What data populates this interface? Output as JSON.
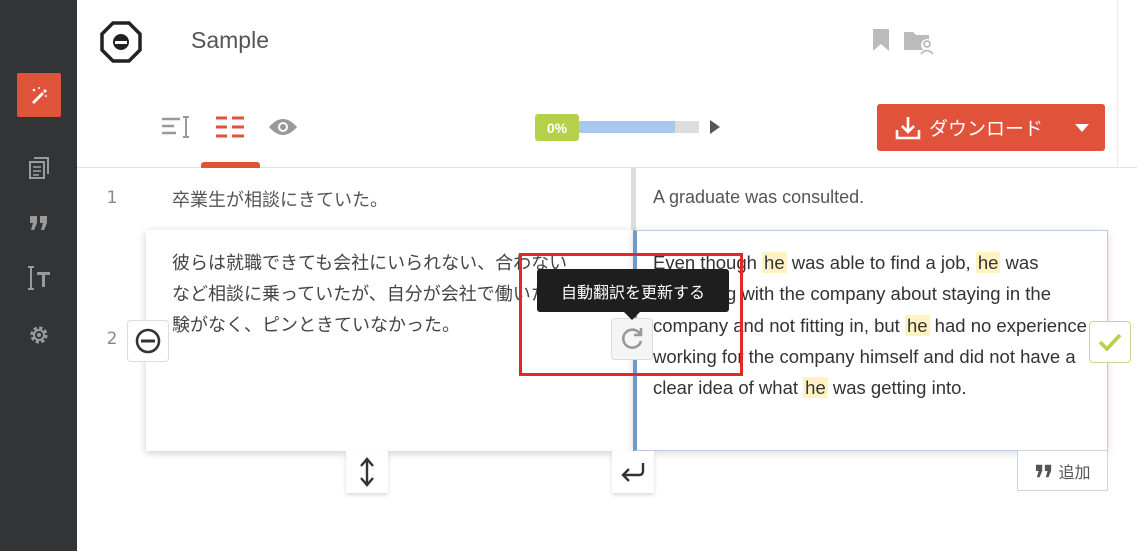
{
  "document": {
    "title": "Sample"
  },
  "progress": {
    "label": "0%",
    "fraction": 0.0,
    "bar_visual_fill": 0.8
  },
  "download": {
    "label": "ダウンロード"
  },
  "segments": [
    {
      "number": "1",
      "source": "卒業生が相談にきていた。",
      "target": "A graduate was consulted."
    },
    {
      "number": "2",
      "source": "彼らは就職できても会社にいられない、合わないなど相談に乗っていたが、自分が会社で働いた経験がなく、ピンときていなかった。",
      "target_parts": [
        "Even though ",
        "he",
        " was able to find a job, ",
        "he",
        " was consulting with the company about staying in the company and not fitting in, but ",
        "he",
        " had no experience working for the company himself and did not have a clear idea of what ",
        "he",
        " was getting into."
      ]
    }
  ],
  "tooltip": {
    "text": "自動翻訳を更新する"
  },
  "add_button": {
    "label": "追加"
  },
  "colors": {
    "accent": "#e0523a",
    "sidebar": "#333436",
    "progress_label": "#b5d14b",
    "progress_fill": "#a9c8ef",
    "highlight_box": "#e02a2a",
    "term_highlight": "#fff3c4"
  },
  "icons": {
    "sidebar": [
      "edit-icon",
      "documents-icon",
      "quote-icon",
      "text-format-icon",
      "gear-icon"
    ],
    "header": [
      "bookmark-icon",
      "folder-user-icon"
    ],
    "views": [
      "list-text-icon",
      "segments-view-icon",
      "preview-eye-icon"
    ]
  }
}
